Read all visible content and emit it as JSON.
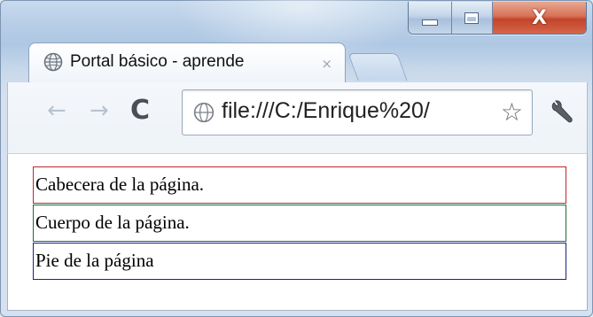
{
  "window": {
    "caption_buttons": {
      "minimize": "minimize",
      "maximize": "maximize",
      "close": "close"
    }
  },
  "tab": {
    "title": "Portal básico - aprende",
    "close_glyph": "×",
    "icon": "globe-icon"
  },
  "toolbar": {
    "back_glyph": "←",
    "forward_glyph": "→",
    "reload_glyph": "C",
    "url": "file:///C:/Enrique%20/",
    "bookmark_glyph": "☆",
    "settings_icon": "wrench-icon"
  },
  "page": {
    "header_text": "Cabecera de la página.",
    "body_text": "Cuerpo de la página.",
    "footer_text": "Pie de la página"
  },
  "colors": {
    "header_border": "#c0262a",
    "body_border": "#1d6b3a",
    "footer_border": "#1a237e",
    "close_button": "#c2442a"
  }
}
